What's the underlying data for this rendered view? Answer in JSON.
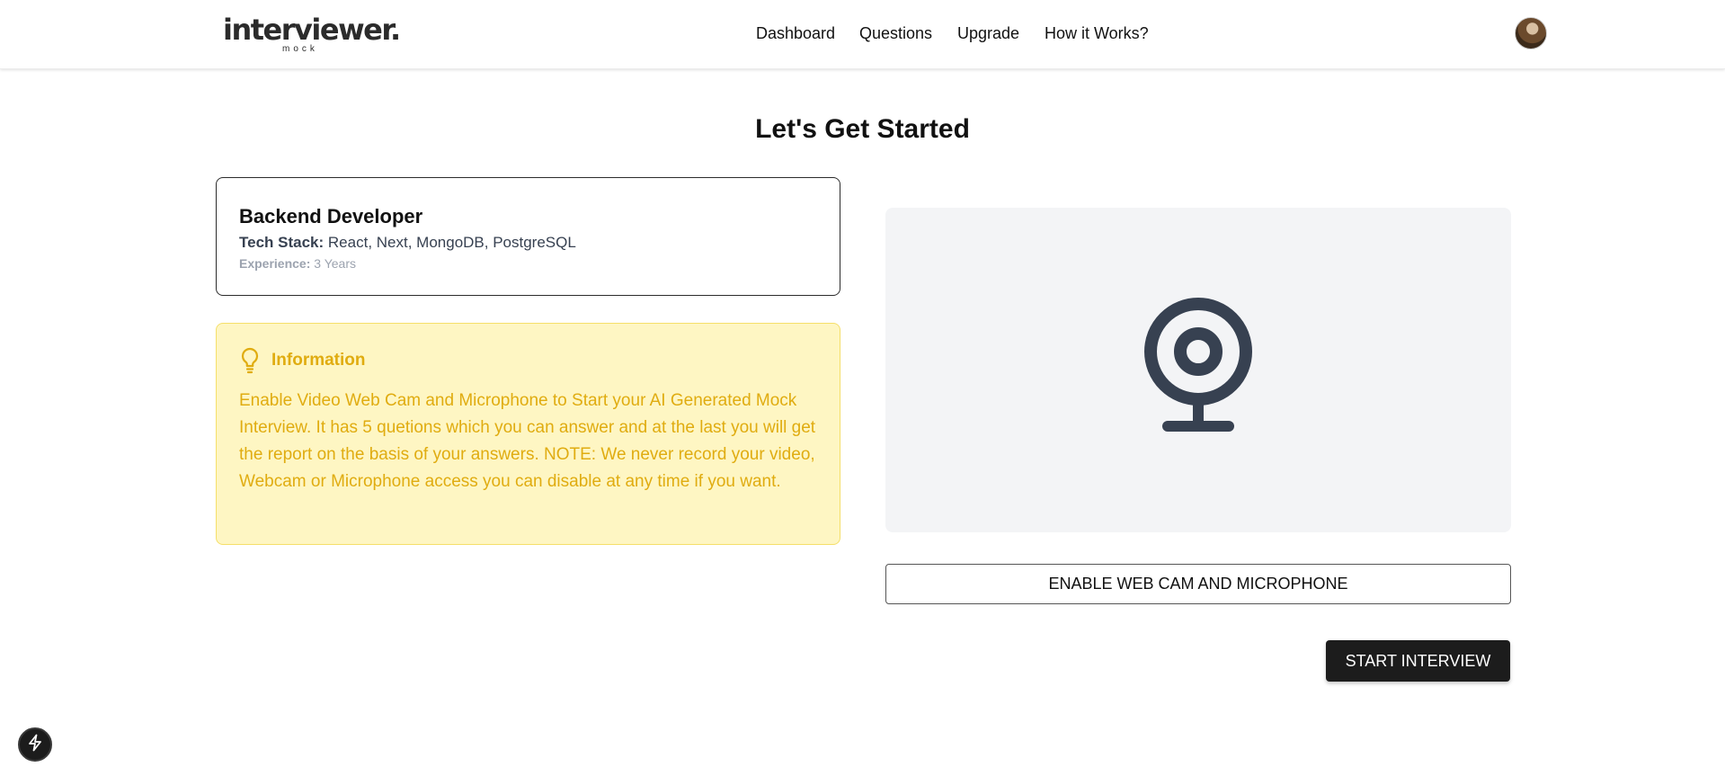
{
  "header": {
    "logo_text": "interviewer.",
    "logo_subtext": "mock",
    "nav": [
      {
        "label": "Dashboard"
      },
      {
        "label": "Questions"
      },
      {
        "label": "Upgrade"
      },
      {
        "label": "How it Works?"
      }
    ],
    "avatar_icon": "user-avatar"
  },
  "main": {
    "title": "Let's Get Started",
    "job": {
      "position": "Backend Developer",
      "tech_stack_label": "Tech Stack:",
      "tech_stack_value": "React, Next, MongoDB, PostgreSQL",
      "experience_label": "Experience:",
      "experience_value": "3 Years"
    },
    "information": {
      "icon": "lightbulb-icon",
      "title": "Information",
      "text": "Enable Video Web Cam and Microphone to Start your AI Generated Mock Interview. It has 5 quetions which you can answer and at the last you will get the report on the basis of your answers. NOTE: We never record your video, Webcam or Microphone access you can disable at any time if you want."
    },
    "webcam": {
      "icon": "webcam-icon",
      "enable_button_label": "ENABLE WEB CAM AND MICROPHONE"
    },
    "start_button_label": "START INTERVIEW"
  },
  "floating_button": {
    "icon": "lightning-icon"
  },
  "colors": {
    "info_bg": "#fef6c3",
    "info_text": "#e0ac10",
    "dark_button": "#1c1c1c",
    "cam_bg": "#f3f4f6",
    "cam_icon": "#374151"
  }
}
